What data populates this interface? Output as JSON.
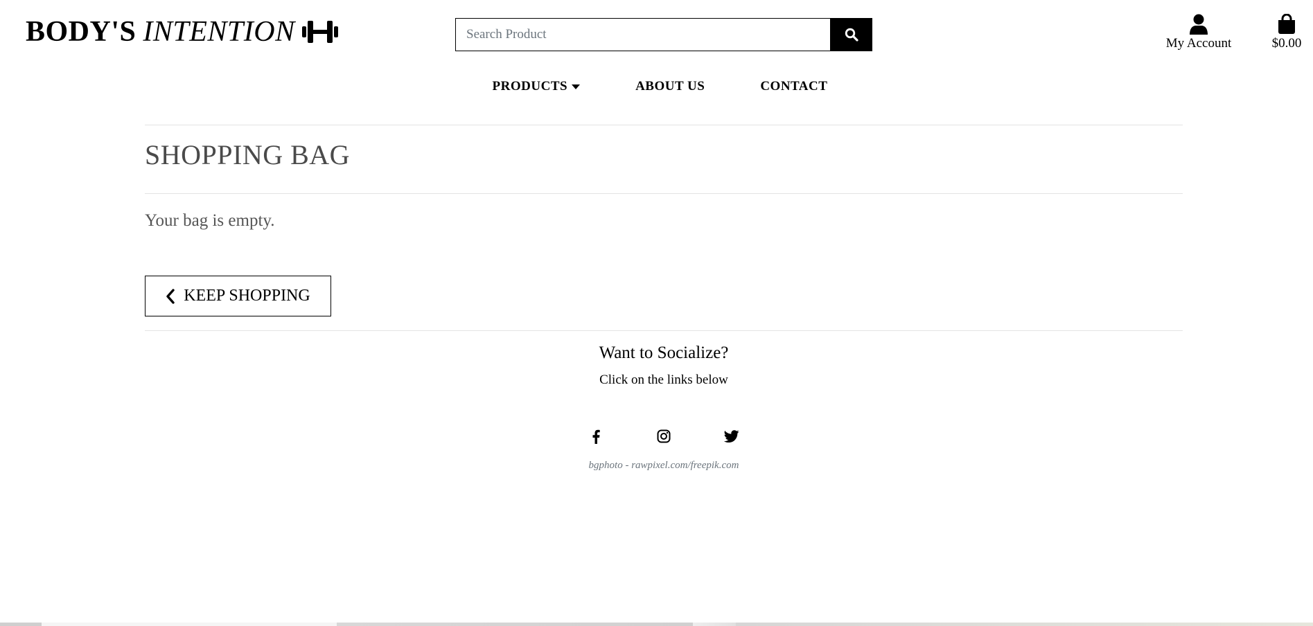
{
  "header": {
    "logo_bold": "BODY'S",
    "logo_italic": "INTENTION",
    "search_placeholder": "Search Product",
    "account_label": "My Account",
    "bag_total": "$0.00"
  },
  "nav": {
    "items": [
      {
        "label": "PRODUCTS",
        "has_dropdown": true
      },
      {
        "label": "ABOUT US"
      },
      {
        "label": "CONTACT"
      }
    ]
  },
  "main": {
    "title": "SHOPPING BAG",
    "empty_message": "Your bag is empty.",
    "keep_shopping_label": "KEEP SHOPPING"
  },
  "footer": {
    "social_title": "Want to Socialize?",
    "social_subtitle": "Click on the links below",
    "social_icons": [
      "facebook-icon",
      "instagram-icon",
      "twitter-icon"
    ],
    "credit": "bgphoto - rawpixel.com/freepik.com"
  },
  "colors": {
    "accent": "#000000",
    "title_text": "#4a4a4a",
    "muted_text": "#6c757d",
    "divider": "#e3e3e3"
  }
}
